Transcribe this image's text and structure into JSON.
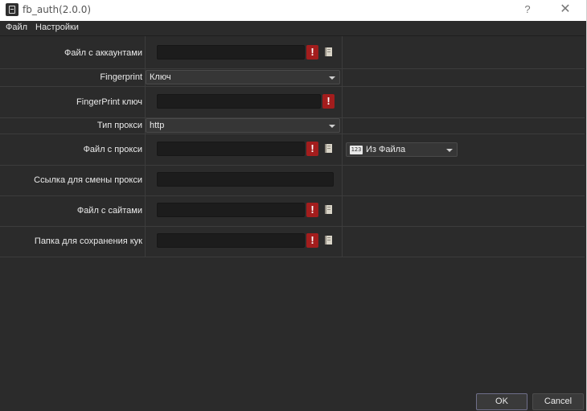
{
  "window": {
    "title": "fb_auth(2.0.0)",
    "help_glyph": "?",
    "close_glyph": "✕"
  },
  "menu": {
    "items": [
      "Файл",
      "Настройки"
    ]
  },
  "form": {
    "accounts_file": {
      "label": "Файл с аккаунтами",
      "value": ""
    },
    "fingerprint": {
      "label": "Fingerprint",
      "selected": "Ключ"
    },
    "fingerprint_key": {
      "label": "FingerPrint ключ",
      "value": ""
    },
    "proxy_type": {
      "label": "Тип прокси",
      "selected": "http"
    },
    "proxy_file": {
      "label": "Файл с прокси",
      "value": "",
      "source_selected": "Из Файла",
      "source_icon": "123"
    },
    "proxy_change_link": {
      "label": "Ссылка для смены прокси",
      "value": ""
    },
    "sites_file": {
      "label": "Файл с сайтами",
      "value": ""
    },
    "cookies_folder": {
      "label": "Папка для сохранения кук",
      "value": ""
    }
  },
  "warn_glyph": "!",
  "buttons": {
    "ok": "OK",
    "cancel": "Cancel"
  },
  "colors": {
    "background": "#2b2b2b",
    "warning": "#a31d1d",
    "field": "#1c1c1c"
  }
}
